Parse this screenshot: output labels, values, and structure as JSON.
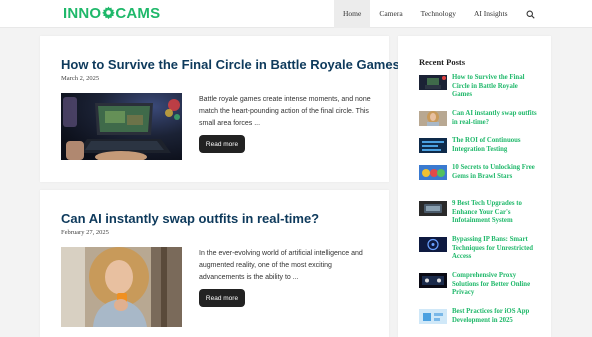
{
  "site": {
    "logo_left": "INNO",
    "logo_right": "CAMS"
  },
  "nav": {
    "items": [
      {
        "label": "Home",
        "active": true
      },
      {
        "label": "Camera",
        "active": false
      },
      {
        "label": "Technology",
        "active": false
      },
      {
        "label": "AI Insights",
        "active": false
      }
    ]
  },
  "posts": [
    {
      "title": "How to Survive the Final Circle in Battle Royale Games",
      "date": "March 2, 2025",
      "excerpt": "Battle royale games create intense moments, and none match the heart-pounding action of the final circle. This small area forces ...",
      "button": "Read more"
    },
    {
      "title": "Can AI instantly swap outfits in real-time?",
      "date": "February 27, 2025",
      "excerpt": "In the ever-evolving world of artificial intelligence and augmented reality, one of the most exciting advancements is the ability to ...",
      "button": "Read more"
    }
  ],
  "sidebar": {
    "title": "Recent Posts",
    "items": [
      {
        "text": "How to Survive the Final Circle in Battle Royale Games"
      },
      {
        "text": "Can AI instantly swap outfits in real-time?"
      },
      {
        "text": "The ROI of Continuous Integration Testing"
      },
      {
        "text": "10 Secrets to Unlocking Free Gems in Brawl Stars"
      },
      {
        "text": "9 Best Tech Upgrades to Enhance Your Car's Infotainment System"
      },
      {
        "text": "Bypassing IP Bans: Smart Techniques for Unrestricted Access"
      },
      {
        "text": "Comprehensive Proxy Solutions for Better Online Privacy"
      },
      {
        "text": "Best Practices for iOS App Development in 2025"
      }
    ]
  },
  "colors": {
    "accent": "#1fb86a",
    "title": "#0e3a5c",
    "button": "#222222"
  },
  "icons": {
    "logo": "gear-icon",
    "search": "search-icon"
  }
}
